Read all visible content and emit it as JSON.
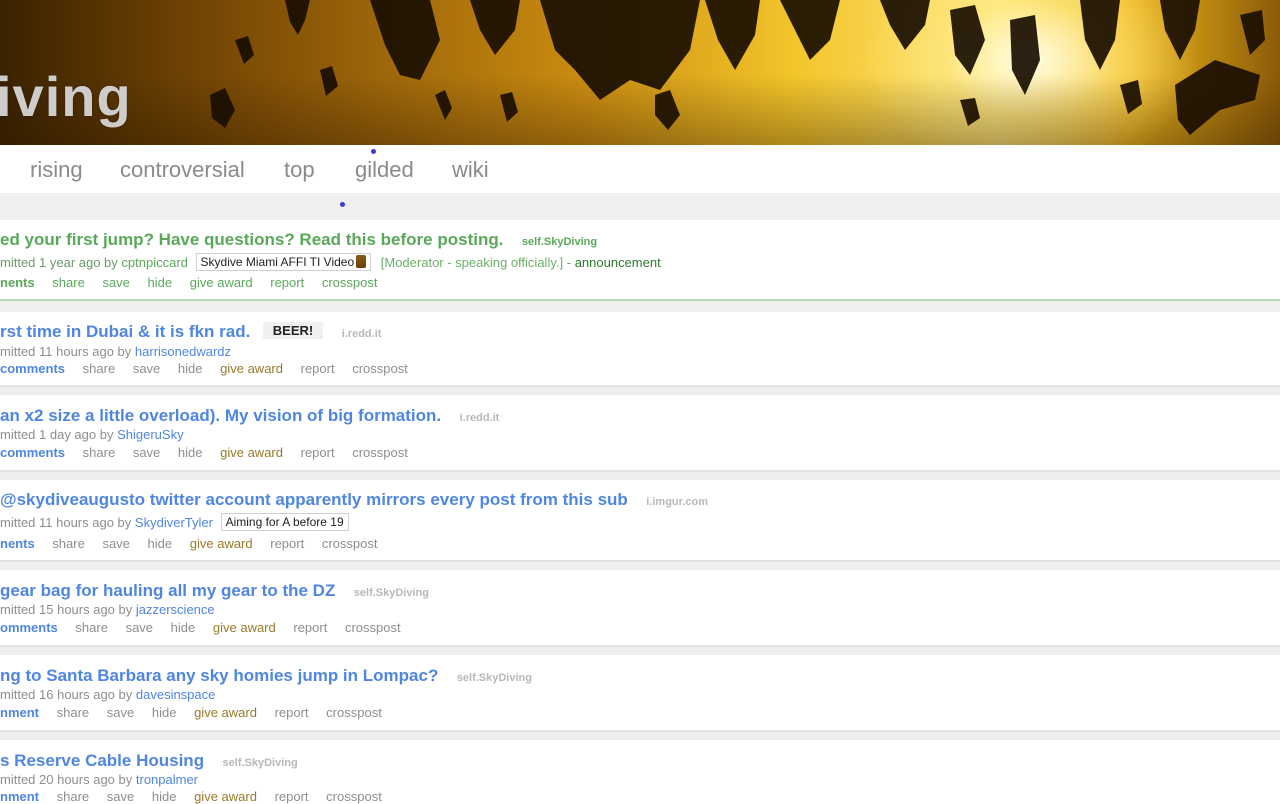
{
  "banner": {
    "title": "iving"
  },
  "tabs": [
    "rising",
    "controversial",
    "top",
    "gilded",
    "wiki"
  ],
  "posts": [
    {
      "title": "ed your first jump? Have questions? Read this before posting.",
      "domain": "self.SkyDiving",
      "meta_prefix": "mitted 1 year ago by",
      "author": "cptnpiccard",
      "flair": "Skydive Miami AFFI TI Video",
      "mod_tag": "[Moderator - speaking officially.]",
      "sep": "-",
      "announcement": "announcement",
      "comments": "nents",
      "actions": [
        "share",
        "save",
        "hide",
        "give award",
        "report",
        "crosspost"
      ]
    },
    {
      "title": "rst time in Dubai & it is fkn rad.",
      "tag": "BEER!",
      "domain": "i.redd.it",
      "meta_prefix": "mitted 11 hours ago by",
      "author": "harrisonedwardz",
      "comments": "comments",
      "actions": [
        "share",
        "save",
        "hide",
        "give award",
        "report",
        "crosspost"
      ]
    },
    {
      "title": "an x2 size a little overload). My vision of big formation.",
      "domain": "i.redd.it",
      "meta_prefix": "mitted 1 day ago by",
      "author": "ShigeruSky",
      "comments": "comments",
      "actions": [
        "share",
        "save",
        "hide",
        "give award",
        "report",
        "crosspost"
      ]
    },
    {
      "title": "@skydiveaugusto twitter account apparently mirrors every post from this sub",
      "domain": "i.imgur.com",
      "meta_prefix": "mitted 11 hours ago by",
      "author": "SkydiverTyler",
      "flair": "Aiming for A before 19",
      "comments": "nents",
      "actions": [
        "share",
        "save",
        "hide",
        "give award",
        "report",
        "crosspost"
      ]
    },
    {
      "title": "gear bag for hauling all my gear to the DZ",
      "domain": "self.SkyDiving",
      "meta_prefix": "mitted 15 hours ago by",
      "author": "jazzerscience",
      "comments": "omments",
      "actions": [
        "share",
        "save",
        "hide",
        "give award",
        "report",
        "crosspost"
      ]
    },
    {
      "title": "ng to Santa Barbara any sky homies jump in Lompac?",
      "domain": "self.SkyDiving",
      "meta_prefix": "mitted 16 hours ago by",
      "author": "davesinspace",
      "comments": "nment",
      "actions": [
        "share",
        "save",
        "hide",
        "give award",
        "report",
        "crosspost"
      ]
    },
    {
      "title": "s Reserve Cable Housing",
      "domain": "self.SkyDiving",
      "meta_prefix": "mitted 20 hours ago by",
      "author": "tronpalmer",
      "comments": "nment",
      "actions": [
        "share",
        "save",
        "hide",
        "give award",
        "report",
        "crosspost"
      ]
    }
  ]
}
